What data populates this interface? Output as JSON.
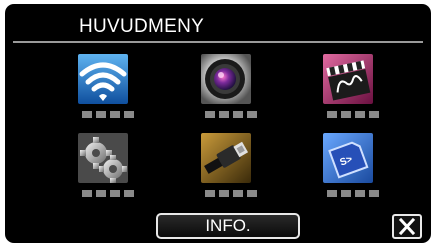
{
  "menu": {
    "title": "HUVUDMENY",
    "tiles": [
      {
        "icon": "wifi-icon",
        "page_indicators": 4,
        "background": "#1d6fc4"
      },
      {
        "icon": "camera-lens-icon",
        "page_indicators": 4,
        "background": "#c9c9c9"
      },
      {
        "icon": "effect-clapperboard-icon",
        "page_indicators": 4,
        "background": "#8a1f55"
      },
      {
        "icon": "gears-icon",
        "page_indicators": 4,
        "background": "#8a8a8a"
      },
      {
        "icon": "hdmi-cable-icon",
        "page_indicators": 4,
        "background": "#7a5a1e"
      },
      {
        "icon": "sd-card-icon",
        "page_indicators": 4,
        "background": "#2d63c8"
      }
    ]
  },
  "footer": {
    "info_label": "INFO.",
    "close_icon": "close-x-icon"
  },
  "colors": {
    "panel_background": "#000000",
    "text": "#ffffff",
    "title_divider": "#9a9a9a",
    "indicator": "#8a8a8a"
  }
}
